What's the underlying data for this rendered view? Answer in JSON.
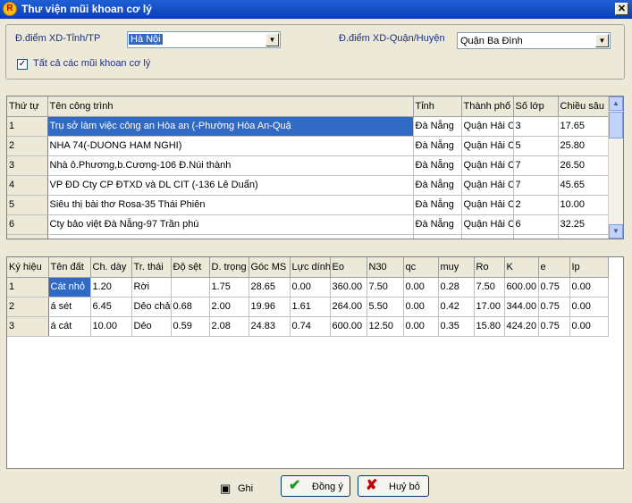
{
  "window": {
    "title": "Thư viện mũi khoan cơ lý",
    "icon_text": "R",
    "close_symbol": "✕"
  },
  "filters": {
    "province_label": "Đ.điểm XD-Tỉnh/TP",
    "province_value": "Hà Nội",
    "district_label": "Đ.điểm XD-Quận/Huyện",
    "district_value": "Quận Ba Đình",
    "all_label": "Tất cả các mũi khoan cơ lý",
    "all_checked": true
  },
  "boreholes": {
    "headers": [
      "Thứ tự",
      "Tên công trình",
      "Tỉnh",
      "Thành phố",
      "Số lớp",
      "Chiều sâu"
    ],
    "rows": [
      [
        "1",
        "Trụ sở làm việc công an Hòa an (-Phường Hòa An-Quậ",
        "Đà Nẵng",
        "Quận Hải C",
        "3",
        "17.65"
      ],
      [
        "2",
        "NHA 74(-DUONG HAM NGHI)",
        "Đà Nẵng",
        "Quận Hải C",
        "5",
        "25.80"
      ],
      [
        "3",
        "Nhà ô.Phương,b.Cương-106 Đ.Núi thành",
        "Đà Nẵng",
        "Quận Hải C",
        "7",
        "26.50"
      ],
      [
        "4",
        "VP ĐD Cty CP ĐTXD và DL CIT (-136 Lê Duẩn)",
        "Đà Nẵng",
        "Quận Hải C",
        "7",
        "45.65"
      ],
      [
        "5",
        "Siêu thị bài thơ Rosa-35 Thái Phiên",
        "Đà Nẵng",
        "Quận Hải C",
        "2",
        "10.00"
      ],
      [
        "6",
        "Cty bảo việt Đà Nẵng-97 Trần phú",
        "Đà Nẵng",
        "Quận Hải C",
        "6",
        "32.25"
      ],
      [
        "7",
        "",
        "",
        "",
        "",
        ""
      ]
    ]
  },
  "layers": {
    "headers": [
      "Ký hiệu",
      "Tên đất",
      "Ch. dày",
      "Tr. thái",
      "Độ sệt",
      "D. trọng",
      "Góc MS",
      "Lực dính",
      "Eo",
      "N30",
      "qc",
      "muy",
      "Ro",
      "K",
      "e",
      "Ip"
    ],
    "rows": [
      [
        "1",
        "Cát nhỏ",
        "1.20",
        "Rời",
        "",
        "1.75",
        "28.65",
        "0.00",
        "360.00",
        "7.50",
        "0.00",
        "0.28",
        "7.50",
        "600.00",
        "0.75",
        "0.00"
      ],
      [
        "2",
        "á sét",
        "6.45",
        "Dẻo chảy",
        "0.68",
        "2.00",
        "19.96",
        "1.61",
        "264.00",
        "5.50",
        "0.00",
        "0.42",
        "17.00",
        "344.00",
        "0.75",
        "0.00"
      ],
      [
        "3",
        "á cát",
        "10.00",
        "Dẻo",
        "0.59",
        "2.08",
        "24.83",
        "0.74",
        "600.00",
        "12.50",
        "0.00",
        "0.35",
        "15.80",
        "424.20",
        "0.75",
        "0.00"
      ]
    ]
  },
  "buttons": {
    "save_label": "Ghi",
    "ok_label": "Đồng ý",
    "cancel_label": "Huỷ bỏ"
  },
  "colors": {
    "selection": "#316ac5",
    "title_bar": "#0b3fb4"
  }
}
